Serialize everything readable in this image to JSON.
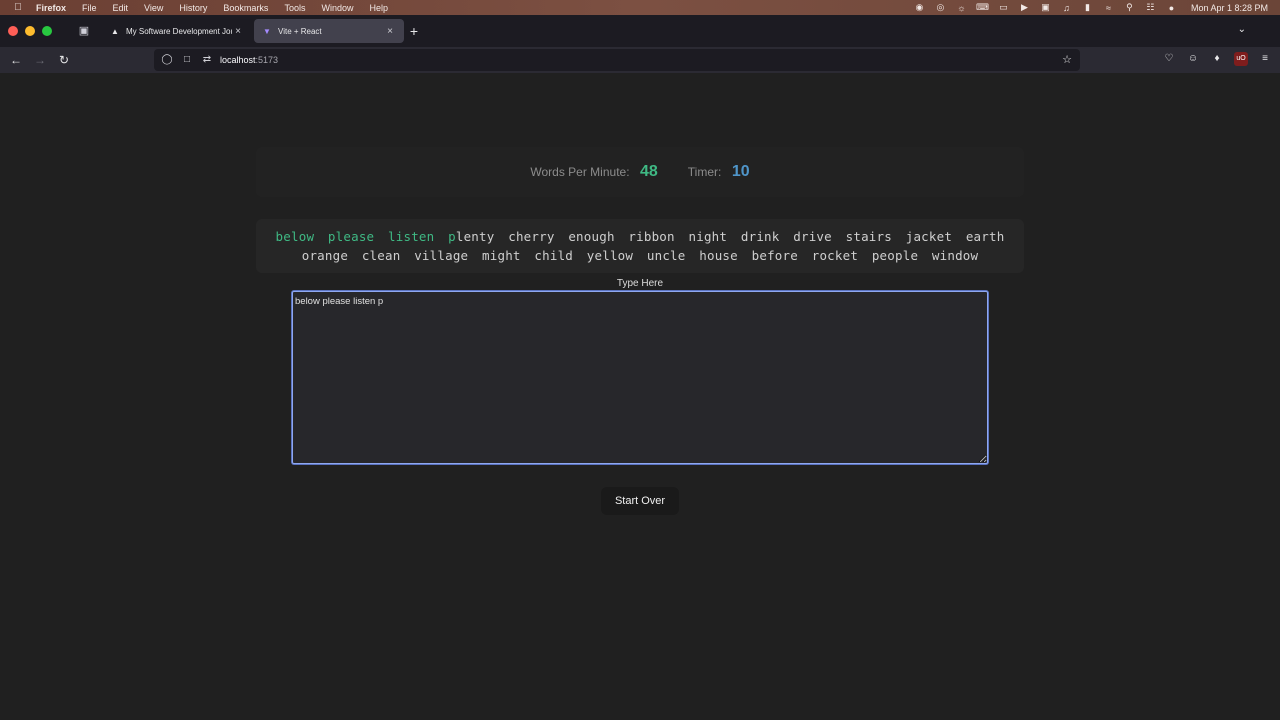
{
  "menubar": {
    "app": "Firefox",
    "items": [
      "File",
      "Edit",
      "View",
      "History",
      "Bookmarks",
      "Tools",
      "Window",
      "Help"
    ],
    "clock": "Mon Apr 1  8:28 PM"
  },
  "tabs": [
    {
      "title": "My Software Development Jour",
      "favicon": "triangle-icon"
    },
    {
      "title": "Vite + React",
      "favicon": "vite-icon"
    }
  ],
  "address": {
    "host": "localhost",
    "port": ":5173"
  },
  "stats": {
    "wpm_label": "Words Per Minute:",
    "wpm_value": "48",
    "timer_label": "Timer:",
    "timer_value": "10"
  },
  "words": {
    "completed": [
      "below",
      "please",
      "listen"
    ],
    "current_typed": "p",
    "current_rest": "lenty",
    "remaining": [
      "cherry",
      "enough",
      "ribbon",
      "night",
      "drink",
      "drive",
      "stairs",
      "jacket",
      "earth",
      "orange",
      "clean",
      "village",
      "might",
      "child",
      "yellow",
      "uncle",
      "house",
      "before",
      "rocket",
      "people",
      "window"
    ]
  },
  "typing": {
    "label": "Type Here",
    "value": "below please listen p"
  },
  "buttons": {
    "start_over": "Start Over"
  },
  "colors": {
    "correct": "#3fb984",
    "timer": "#4f95c9",
    "focus_border": "#8fa8f0"
  }
}
